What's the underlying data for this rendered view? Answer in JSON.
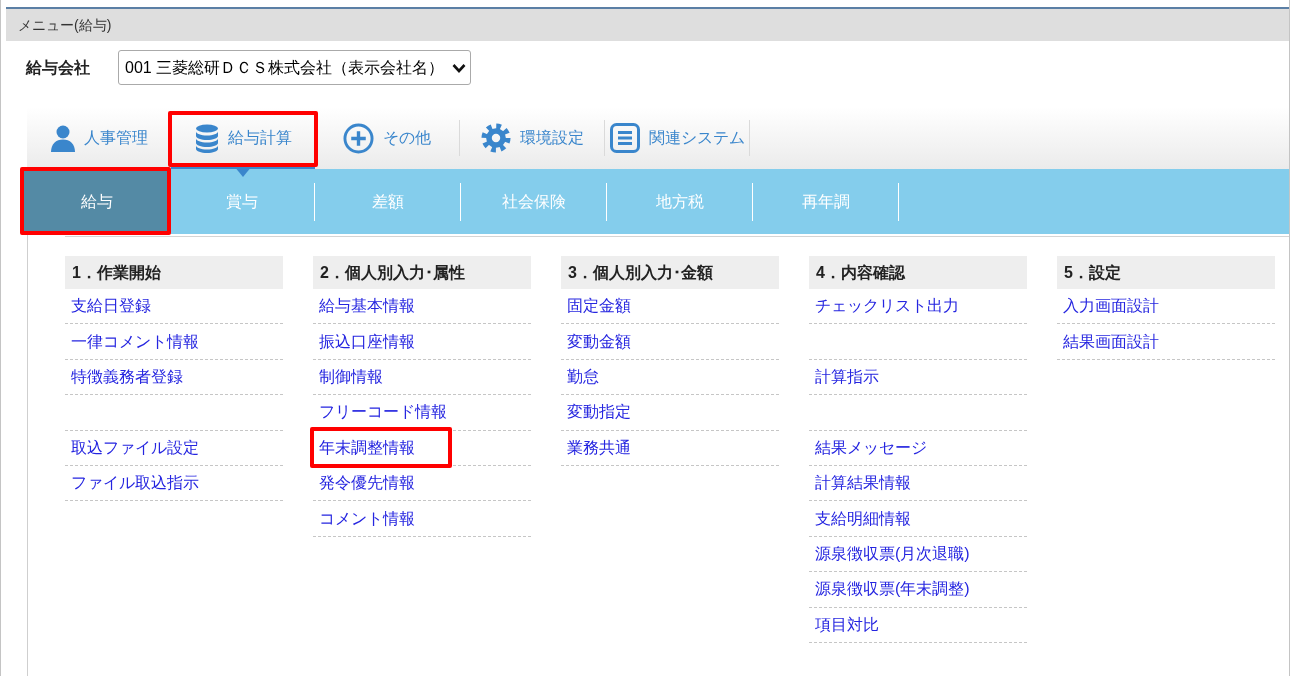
{
  "window": {
    "title": "メニュー(給与)"
  },
  "company": {
    "label": "給与会社",
    "value": "001 三菱総研ＤＣＳ株式会社（表示会社名）"
  },
  "nav": [
    {
      "label": "人事管理",
      "selected": false,
      "highlighted": false
    },
    {
      "label": "給与計算",
      "selected": true,
      "highlighted": true
    },
    {
      "label": "その他",
      "selected": false,
      "highlighted": false
    },
    {
      "label": "環境設定",
      "selected": false,
      "highlighted": false
    },
    {
      "label": "関連システム",
      "selected": false,
      "highlighted": false
    }
  ],
  "tabs": [
    {
      "label": "給与",
      "selected": true,
      "highlighted": true
    },
    {
      "label": "賞与",
      "selected": false,
      "highlighted": false
    },
    {
      "label": "差額",
      "selected": false,
      "highlighted": false
    },
    {
      "label": "社会保険",
      "selected": false,
      "highlighted": false
    },
    {
      "label": "地方税",
      "selected": false,
      "highlighted": false
    },
    {
      "label": "再年調",
      "selected": false,
      "highlighted": false
    }
  ],
  "menu_columns": [
    {
      "title": "1．作業開始",
      "items": [
        {
          "kind": "link",
          "label": "支給日登録",
          "highlighted": false
        },
        {
          "kind": "link",
          "label": "一律コメント情報",
          "highlighted": false
        },
        {
          "kind": "link",
          "label": "特徴義務者登録",
          "highlighted": false
        },
        {
          "kind": "blank"
        },
        {
          "kind": "link",
          "label": "取込ファイル設定",
          "highlighted": false
        },
        {
          "kind": "link",
          "label": "ファイル取込指示",
          "highlighted": false
        }
      ]
    },
    {
      "title": "2．個人別入力･属性",
      "items": [
        {
          "kind": "link",
          "label": "給与基本情報",
          "highlighted": false
        },
        {
          "kind": "link",
          "label": "振込口座情報",
          "highlighted": false
        },
        {
          "kind": "link",
          "label": "制御情報",
          "highlighted": false
        },
        {
          "kind": "link",
          "label": "フリーコード情報",
          "highlighted": false
        },
        {
          "kind": "link",
          "label": "年末調整情報",
          "highlighted": true
        },
        {
          "kind": "link",
          "label": "発令優先情報",
          "highlighted": false
        },
        {
          "kind": "link",
          "label": "コメント情報",
          "highlighted": false
        }
      ]
    },
    {
      "title": "3．個人別入力･金額",
      "items": [
        {
          "kind": "link",
          "label": "固定金額",
          "highlighted": false
        },
        {
          "kind": "link",
          "label": "変動金額",
          "highlighted": false
        },
        {
          "kind": "link",
          "label": "勤怠",
          "highlighted": false
        },
        {
          "kind": "link",
          "label": "変動指定",
          "highlighted": false
        },
        {
          "kind": "link",
          "label": "業務共通",
          "highlighted": false
        }
      ]
    },
    {
      "title": "4．内容確認",
      "items": [
        {
          "kind": "link",
          "label": "チェックリスト出力",
          "highlighted": false
        },
        {
          "kind": "blank"
        },
        {
          "kind": "link",
          "label": "計算指示",
          "highlighted": false
        },
        {
          "kind": "blank"
        },
        {
          "kind": "link",
          "label": "結果メッセージ",
          "highlighted": false
        },
        {
          "kind": "link",
          "label": "計算結果情報",
          "highlighted": false
        },
        {
          "kind": "link",
          "label": "支給明細情報",
          "highlighted": false
        },
        {
          "kind": "link",
          "label": "源泉徴収票(月次退職)",
          "highlighted": false
        },
        {
          "kind": "link",
          "label": "源泉徴収票(年末調整)",
          "highlighted": false
        },
        {
          "kind": "link",
          "label": "項目対比",
          "highlighted": false
        }
      ]
    },
    {
      "title": "5．設定",
      "items": [
        {
          "kind": "link",
          "label": "入力画面設計",
          "highlighted": false
        },
        {
          "kind": "link",
          "label": "結果画面設計",
          "highlighted": false
        }
      ]
    }
  ]
}
